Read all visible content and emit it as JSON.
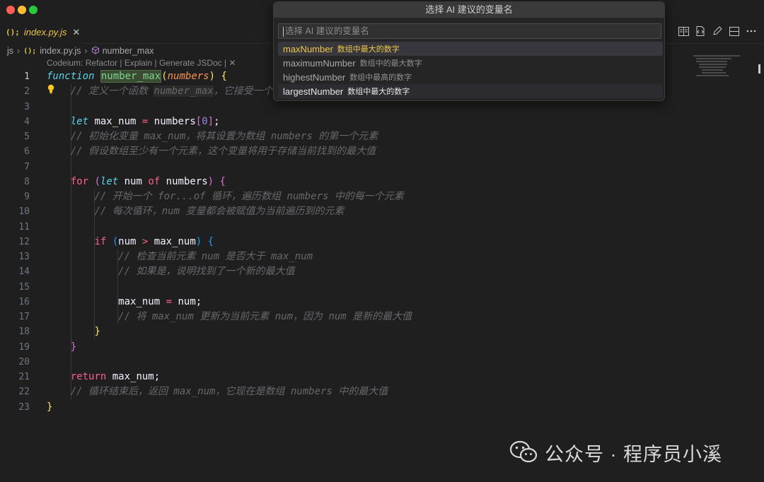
{
  "tab": {
    "icon": "(); ",
    "label": "index.py.js",
    "close": "✕"
  },
  "breadcrumb": {
    "root": "js",
    "file_icon": "();",
    "file": "index.py.js",
    "symbol_icon": "cube-icon",
    "symbol": "number_max"
  },
  "codelens": {
    "text": "Codeium: Refactor | Explain | Generate JSDoc | ✕"
  },
  "editor": {
    "line_numbers": [
      "1",
      "2",
      "3",
      "4",
      "5",
      "6",
      "7",
      "8",
      "9",
      "10",
      "11",
      "12",
      "13",
      "14",
      "15",
      "16",
      "17",
      "18",
      "19",
      "20",
      "21",
      "22",
      "23"
    ],
    "comments": {
      "l2a": "// 定义一个函数 ",
      "l2b": "number_max",
      "l2c": "，它接受一个",
      "l5": "// 初始化变量 max_num，将其设置为数组 numbers 的第一个元素",
      "l6": "// 假设数组至少有一个元素，这个变量将用于存储当前找到的最大值",
      "l9": "// 开始一个 for...of 循环，遍历数组 numbers 中的每一个元素",
      "l10": "// 每次循环，num 变量都会被赋值为当前遍历到的元素",
      "l13": "// 检查当前元素 num 是否大于 max_num",
      "l14": "// 如果是，说明找到了一个新的最大值",
      "l17": "// 将 max_num 更新为当前元素 num，因为 num 是新的最大值",
      "l22": "// 循环结束后，返回 max_num，它现在是数组 numbers 中的最大值"
    },
    "tokens": {
      "function": "function",
      "fn_name": "number_max",
      "param": "numbers",
      "let": "let",
      "max_num": "max_num",
      "numbers": "numbers",
      "zero": "0",
      "for": "for",
      "num": "num",
      "of": "of",
      "if": "if",
      "return": "return"
    }
  },
  "quickpick": {
    "title": "选择 AI 建议的变量名",
    "placeholder": "选择 AI 建议的变量名",
    "items": [
      {
        "name": "maxNumber",
        "desc": "数组中最大的数字",
        "state": "selected"
      },
      {
        "name": "maximumNumber",
        "desc": "数组中的最大数字",
        "state": "normal"
      },
      {
        "name": "highestNumber",
        "desc": "数组中最高的数字",
        "state": "normal"
      },
      {
        "name": "largestNumber",
        "desc": "数组中最大的数字",
        "state": "hover"
      }
    ]
  },
  "watermark": {
    "text": "公众号 · 程序员小溪"
  },
  "colors": {
    "accent": "#f0c649",
    "keyword": "#fc618d",
    "function": "#7bd88f",
    "param": "#fd9353",
    "comment": "#69676c"
  }
}
